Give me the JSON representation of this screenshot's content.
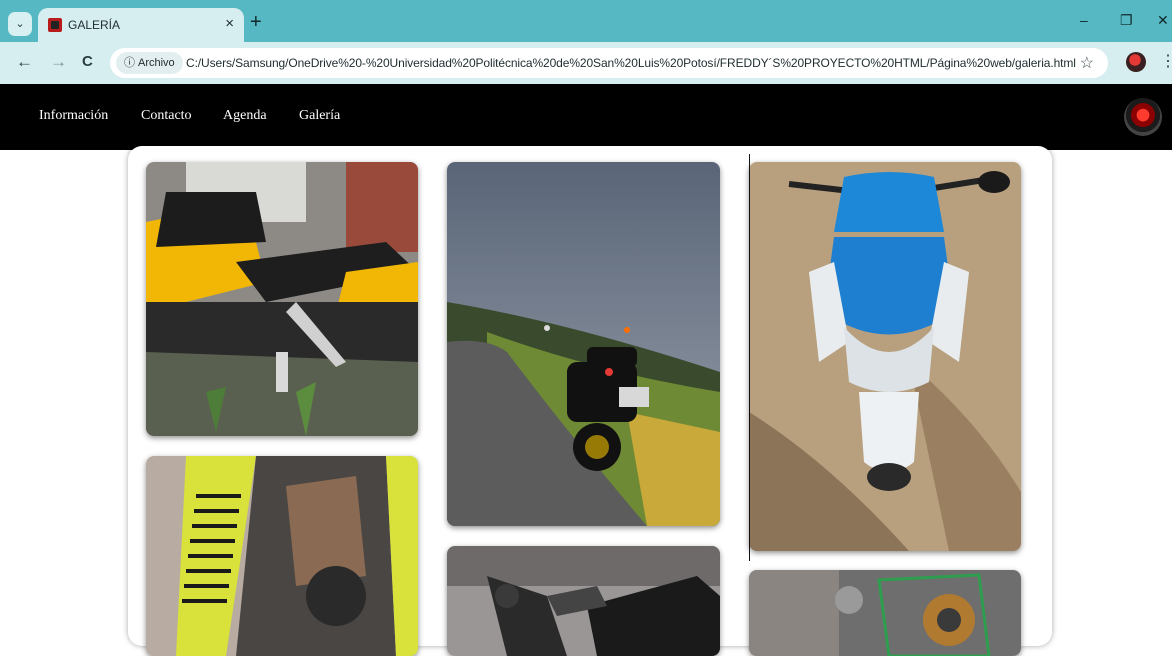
{
  "browser": {
    "tab": {
      "title": "GALERÍA",
      "close": "×"
    },
    "new_tab": "+",
    "window": {
      "minimize": "–",
      "restore": "❐",
      "close": "✕"
    },
    "nav": {
      "back": "←",
      "forward": "→",
      "reload": "C"
    },
    "address": {
      "chip_label": "Archivo",
      "chip_icon": "ⓘ",
      "url": "C:/Users/Samsung/OneDrive%20-%20Universidad%20Politécnica%20de%20San%20Luis%20Potosí/FREDDY´S%20PROYECTO%20HTML/Página%20web/galeria.html",
      "bookmark_icon": "☆"
    },
    "menu_icon": "⋮",
    "tab_menu_icon": "⌄"
  },
  "site": {
    "nav": {
      "items": [
        "Información",
        "Contacto",
        "Agenda",
        "Galería"
      ]
    }
  },
  "gallery": {
    "photos": [
      {
        "name": "yellow-black-motorcycle-photo",
        "colors": [
          "#f2b705",
          "#222"
        ]
      },
      {
        "name": "yellow-panel-motorcycle-photo",
        "colors": [
          "#d8e23a",
          "#333"
        ]
      },
      {
        "name": "motorcycle-on-road-photo",
        "colors": [
          "#6f7d90",
          "#3b4a2e"
        ]
      },
      {
        "name": "motorcycle-frame-photo",
        "colors": [
          "#888",
          "#222"
        ]
      },
      {
        "name": "blue-scooter-photo",
        "colors": [
          "#1e88d8",
          "#b89a78"
        ]
      },
      {
        "name": "engine-parts-photo",
        "colors": [
          "#7a7a7a",
          "#2e7d32"
        ]
      }
    ]
  }
}
